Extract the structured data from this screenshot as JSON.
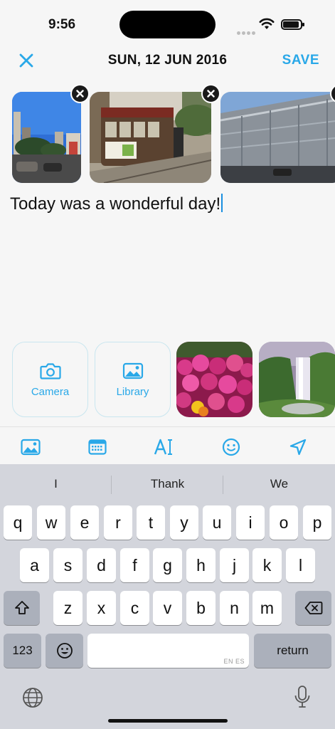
{
  "status": {
    "time": "9:56"
  },
  "header": {
    "date": "SUN, 12 JUN 2016",
    "save_label": "SAVE"
  },
  "photos": [
    {
      "subject": "city street with palm trees"
    },
    {
      "subject": "san francisco cable car"
    },
    {
      "subject": "modern glass building"
    }
  ],
  "entry": {
    "text": "Today was a wonderful day!"
  },
  "media": {
    "camera_label": "Camera",
    "library_label": "Library"
  },
  "toolbar": {
    "items": [
      "image-icon",
      "calendar-keyboard-icon",
      "text-format-icon",
      "emoji-icon",
      "location-icon"
    ]
  },
  "keyboard": {
    "suggestions": [
      "I",
      "Thank",
      "We"
    ],
    "row1": [
      "q",
      "w",
      "e",
      "r",
      "t",
      "y",
      "u",
      "i",
      "o",
      "p"
    ],
    "row2": [
      "a",
      "s",
      "d",
      "f",
      "g",
      "h",
      "j",
      "k",
      "l"
    ],
    "row3": [
      "z",
      "x",
      "c",
      "v",
      "b",
      "n",
      "m"
    ],
    "numbers_label": "123",
    "return_label": "return",
    "space_hint": "EN ES"
  },
  "colors": {
    "accent": "#29a8e8",
    "keyboard_bg": "#d3d5dc"
  }
}
